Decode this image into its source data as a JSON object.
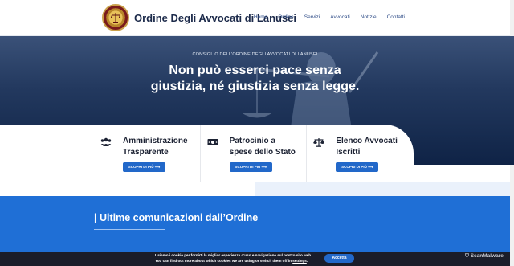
{
  "header": {
    "title": "Ordine Degli Avvocati di Lanusei",
    "nav": [
      "Home",
      "Ordine",
      "Servizi",
      "Avvocati",
      "Notizie",
      "Contatti"
    ]
  },
  "hero": {
    "overline": "CONSIGLIO DELL'ORDINE DEGLI AVVOCATI DI LANUSEI",
    "quote_line1": "Non può esserci pace senza",
    "quote_line2": "giustizia, né giustizia senza legge."
  },
  "cards": [
    {
      "title_line1": "Amministrazione",
      "title_line2": "Trasparente",
      "button": "SCOPRI DI PIÙ ⟶",
      "icon": "users-icon"
    },
    {
      "title_line1": "Patrocinio a",
      "title_line2": "spese dello Stato",
      "button": "SCOPRI DI PIÙ ⟶",
      "icon": "money-bill-icon"
    },
    {
      "title_line1": "Elenco Avvocati",
      "title_line2": "Iscritti",
      "button": "SCOPRI DI PIÙ ⟶",
      "icon": "balance-scale-icon"
    }
  ],
  "section": {
    "title": "| Ultime comunicazioni dall’Ordine"
  },
  "cookie": {
    "line1": "Usiamo i cookie per fornirti la miglior esperienza d'uso e navigazione sul nostro sito web.",
    "line2_prefix": "You can find out more about which cookies we are using or switch them off in ",
    "line2_link": "settings",
    "line2_suffix": ".",
    "accept": "Accetta"
  },
  "watermark": "ScanMalware",
  "colors": {
    "accent": "#2268c9",
    "section_blue": "#1f6fd6",
    "hero_dark": "#0f2346",
    "cookie_bar": "#1a1d2a"
  }
}
